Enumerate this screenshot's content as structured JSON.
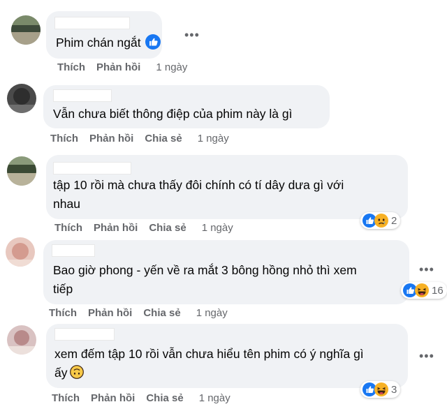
{
  "actions": {
    "like": "Thích",
    "reply": "Phản hồi",
    "share": "Chia sẻ"
  },
  "comments": [
    {
      "text": "Phim chán ngắt",
      "time": "1 ngày"
    },
    {
      "text": "Vẫn chưa biết thông điệp của phim này là gì",
      "time": "1 ngày"
    },
    {
      "text": "tập 10 rồi mà chưa thấy đôi chính có tí dây dưa gì với\nnhau",
      "time": "1 ngày",
      "reaction_count": "2"
    },
    {
      "text": "Bao giờ phong - yến về ra mắt 3 bông hồng nhỏ thì xem\ntiếp",
      "time": "1 ngày",
      "reaction_count": "16"
    },
    {
      "text": "xem đếm tập 10 rồi vẫn chưa hiểu tên phim có ý nghĩa gì\nấy",
      "time": "1 ngày",
      "reaction_count": "3"
    }
  ],
  "more_options_glyph": "•••",
  "colors": {
    "like_blue": "#1877f2",
    "haha_yellow": "#f7b125",
    "bubble_bg": "#f0f2f5",
    "meta_gray": "#65676b"
  }
}
